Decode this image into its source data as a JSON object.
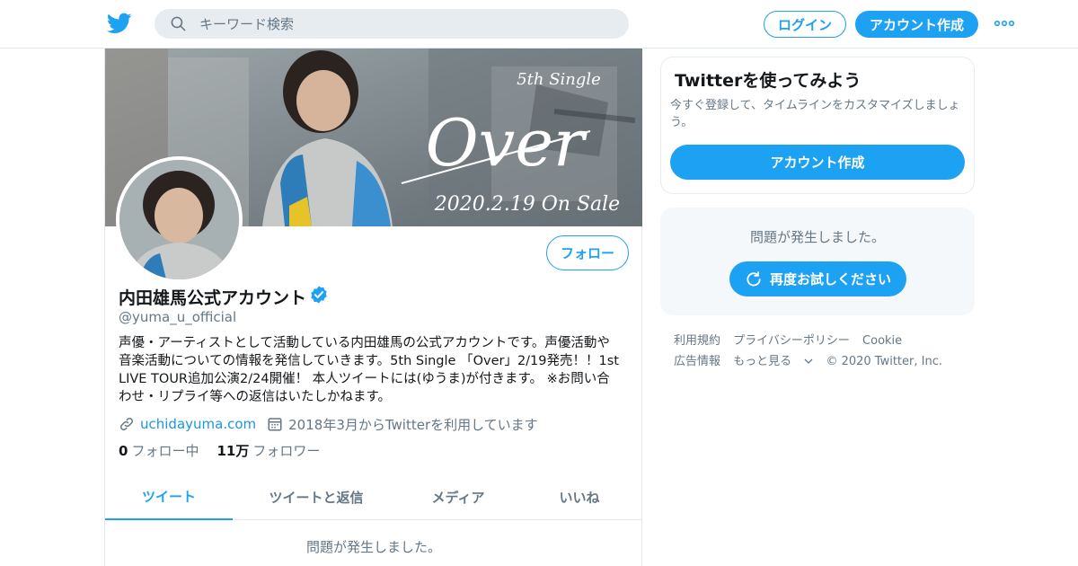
{
  "search": {
    "placeholder": "キーワード検索"
  },
  "header": {
    "login_label": "ログイン",
    "signup_label": "アカウント作成"
  },
  "banner": {
    "subtitle": "5th Single",
    "title": "Over",
    "release": "2020.2.19 On Sale"
  },
  "profile": {
    "display_name": "内田雄馬公式アカウント",
    "handle": "@yuma_u_official",
    "bio": "声優・アーティストとして活動している内田雄馬の公式アカウントです。声優活動や音楽活動についての情報を発信していきます。5th Single 「Over」2/19発売！！1st LIVE TOUR追加公演2/24開催！ 本人ツイートには(ゆうま)が付きます。 ※お問い合わせ・リプライ等への返信はいたしかねます。",
    "url": "uchidayuma.com",
    "joined": "2018年3月からTwitterを利用しています",
    "following_count": "0",
    "following_label": "フォロー中",
    "followers_count": "11万",
    "followers_label": "フォロワー",
    "follow_label": "フォロー"
  },
  "tabs": [
    {
      "label": "ツイート"
    },
    {
      "label": "ツイートと返信"
    },
    {
      "label": "メディア"
    },
    {
      "label": "いいね"
    }
  ],
  "main_error": "問題が発生しました。",
  "sidebar": {
    "signup_title": "Twitterを使ってみよう",
    "signup_text": "今すぐ登録して、タイムラインをカスタマイズしましょう。",
    "signup_button": "アカウント作成",
    "error_message": "問題が発生しました。",
    "retry_label": "再度お試しください"
  },
  "footer": {
    "links": [
      "利用規約",
      "プライバシーポリシー",
      "Cookie",
      "広告情報",
      "もっと見る"
    ],
    "copyright": "© 2020 Twitter, Inc."
  },
  "colors": {
    "accent": "#1da1f2",
    "text_primary": "#14171a",
    "text_secondary": "#657786",
    "border": "#e1e8ed",
    "panel_bg": "#f5f8fa"
  }
}
